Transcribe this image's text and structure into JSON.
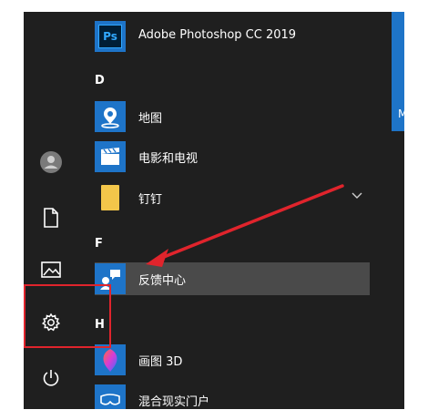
{
  "left_rail": {
    "icons": [
      "user-avatar-icon",
      "document-icon",
      "pictures-icon",
      "gear-icon",
      "power-icon"
    ]
  },
  "apps": {
    "photoshop": {
      "label": "Adobe Photoshop CC 2019",
      "icon_text": "Ps"
    },
    "d_header": "D",
    "map": {
      "label": "地图"
    },
    "movies": {
      "label": "电影和电视"
    },
    "dingtalk": {
      "label": "钉钉"
    },
    "f_header": "F",
    "feedback": {
      "label": "反馈中心"
    },
    "h_header": "H",
    "paint3d": {
      "label": "画图 3D"
    },
    "mixed_reality": {
      "label": "混合现实门户"
    }
  },
  "tile_partial_letter": "M",
  "colors": {
    "accent": "#1e74c8",
    "menu_bg": "#1f1f1f",
    "annotation": "#e0242c"
  }
}
